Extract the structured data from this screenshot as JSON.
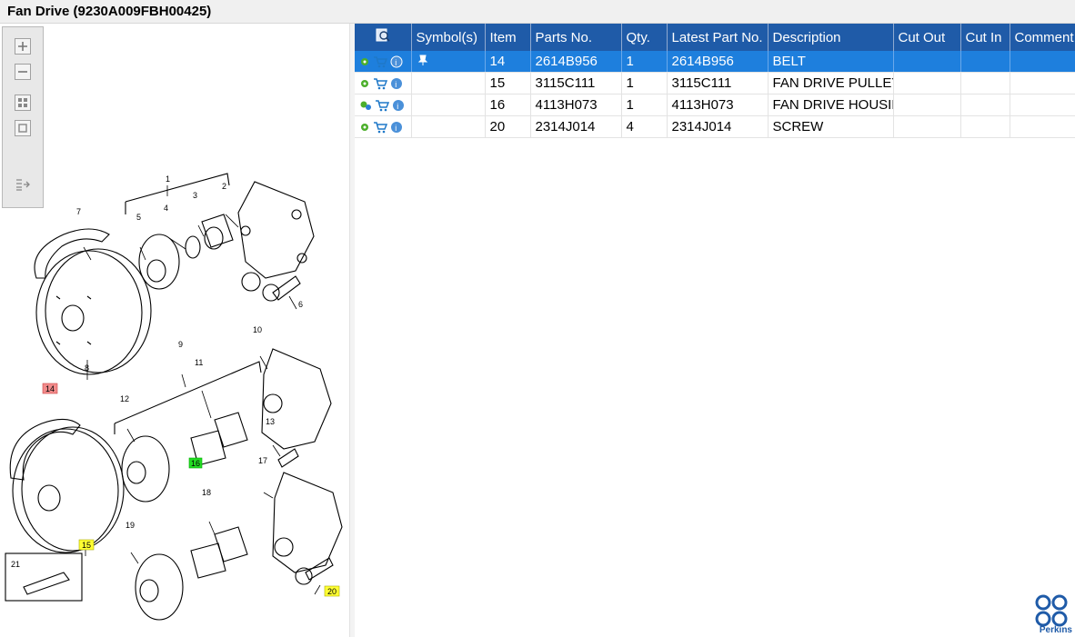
{
  "window": {
    "title": "Fan Drive (9230A009FBH00425)"
  },
  "toolbar": {
    "buttons": [
      {
        "name": "zoom-in-icon"
      },
      {
        "name": "zoom-out-icon"
      },
      {
        "name": "fit-all-icon"
      },
      {
        "name": "fit-page-icon"
      },
      {
        "name": "panel-switch-icon"
      }
    ]
  },
  "diagram": {
    "callouts": [
      "1",
      "2",
      "3",
      "4",
      "5",
      "6",
      "7",
      "8",
      "9",
      "10",
      "11",
      "12",
      "13",
      "17",
      "18",
      "19",
      "21"
    ],
    "highlighted": [
      {
        "label": "14",
        "color": "#f28b8b"
      },
      {
        "label": "16",
        "color": "#22dd22"
      },
      {
        "label": "15",
        "color": "#ffff33"
      },
      {
        "label": "20",
        "color": "#ffff33"
      }
    ]
  },
  "table": {
    "columns": [
      "Symbol(s)",
      "Item",
      "Parts No.",
      "Qty.",
      "Latest Part No.",
      "Description",
      "Cut Out",
      "Cut In",
      "Comment"
    ],
    "rows": [
      {
        "item": "14",
        "parts_no": "2614B956",
        "qty": "1",
        "latest": "2614B956",
        "description": "BELT",
        "cut_out": "",
        "cut_in": "",
        "comment": "",
        "symbol": "pin-icon",
        "selected": true
      },
      {
        "item": "15",
        "parts_no": "3115C111",
        "qty": "1",
        "latest": "3115C111",
        "description": "FAN DRIVE PULLEY",
        "cut_out": "",
        "cut_in": "",
        "comment": ""
      },
      {
        "item": "16",
        "parts_no": "4113H073",
        "qty": "1",
        "latest": "4113H073",
        "description": "FAN DRIVE HOUSIN",
        "cut_out": "",
        "cut_in": "",
        "comment": ""
      },
      {
        "item": "20",
        "parts_no": "2314J014",
        "qty": "4",
        "latest": "2314J014",
        "description": "SCREW",
        "cut_out": "",
        "cut_in": "",
        "comment": ""
      }
    ]
  },
  "brand": {
    "name": "Perkins",
    "color": "#1f5ba8"
  },
  "colors": {
    "header": "#1f5ba8",
    "selected_row": "#1e7fdd"
  }
}
